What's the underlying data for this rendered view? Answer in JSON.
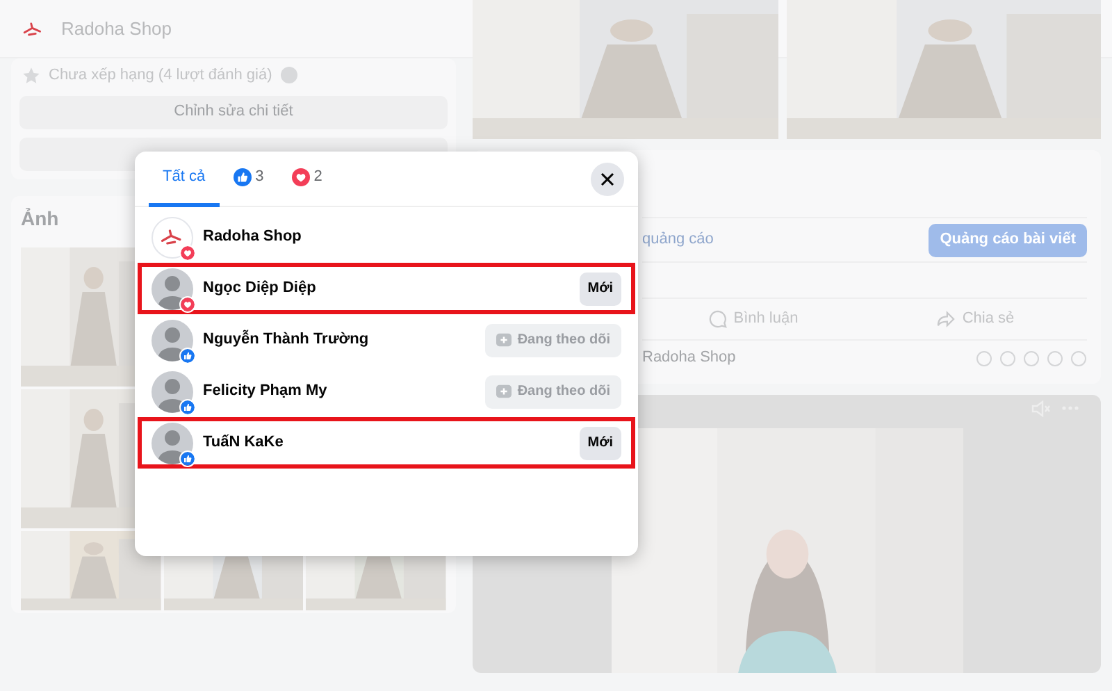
{
  "page": {
    "name": "Radoha Shop",
    "rating": "Chưa xếp hạng (4 lượt đánh giá)",
    "edit_button": "Chỉnh sửa chi tiết",
    "photos_title": "Ảnh"
  },
  "post": {
    "ad_text": "quảng cáo",
    "boost_button": "Quảng cáo bài viết",
    "actions": [
      {
        "kind": "comment",
        "label": "Bình luận"
      },
      {
        "kind": "share",
        "label": "Chia sẻ"
      }
    ],
    "comment_placeholder": "Radoha Shop"
  },
  "dialog": {
    "tabs": [
      {
        "kind": "all",
        "label": "Tất cả",
        "selected": true
      },
      {
        "kind": "like",
        "label": "3",
        "selected": false
      },
      {
        "kind": "love",
        "label": "2",
        "selected": false
      }
    ],
    "people": [
      {
        "name": "Radoha Shop",
        "avatar": {
          "kind": "logo"
        },
        "reaction": {
          "kind": "love"
        },
        "highlighted": false
      },
      {
        "name": "Ngọc Diệp Diệp",
        "avatar": {
          "kind": "person"
        },
        "reaction": {
          "kind": "love"
        },
        "highlighted": true,
        "button": {
          "label": "Mới",
          "disabled": false
        }
      },
      {
        "name": "Nguyễn Thành Trường",
        "avatar": {
          "kind": "person"
        },
        "reaction": {
          "kind": "like"
        },
        "highlighted": false,
        "button": {
          "label": "Đang theo dõi",
          "disabled": true
        }
      },
      {
        "name": "Felicity Phạm My",
        "avatar": {
          "kind": "person"
        },
        "reaction": {
          "kind": "like"
        },
        "highlighted": false,
        "button": {
          "label": "Đang theo dõi",
          "disabled": true
        }
      },
      {
        "name": "TuấN KaKe",
        "avatar": {
          "kind": "person"
        },
        "reaction": {
          "kind": "like"
        },
        "highlighted": true,
        "button": {
          "label": "Mới",
          "disabled": false
        }
      }
    ]
  }
}
